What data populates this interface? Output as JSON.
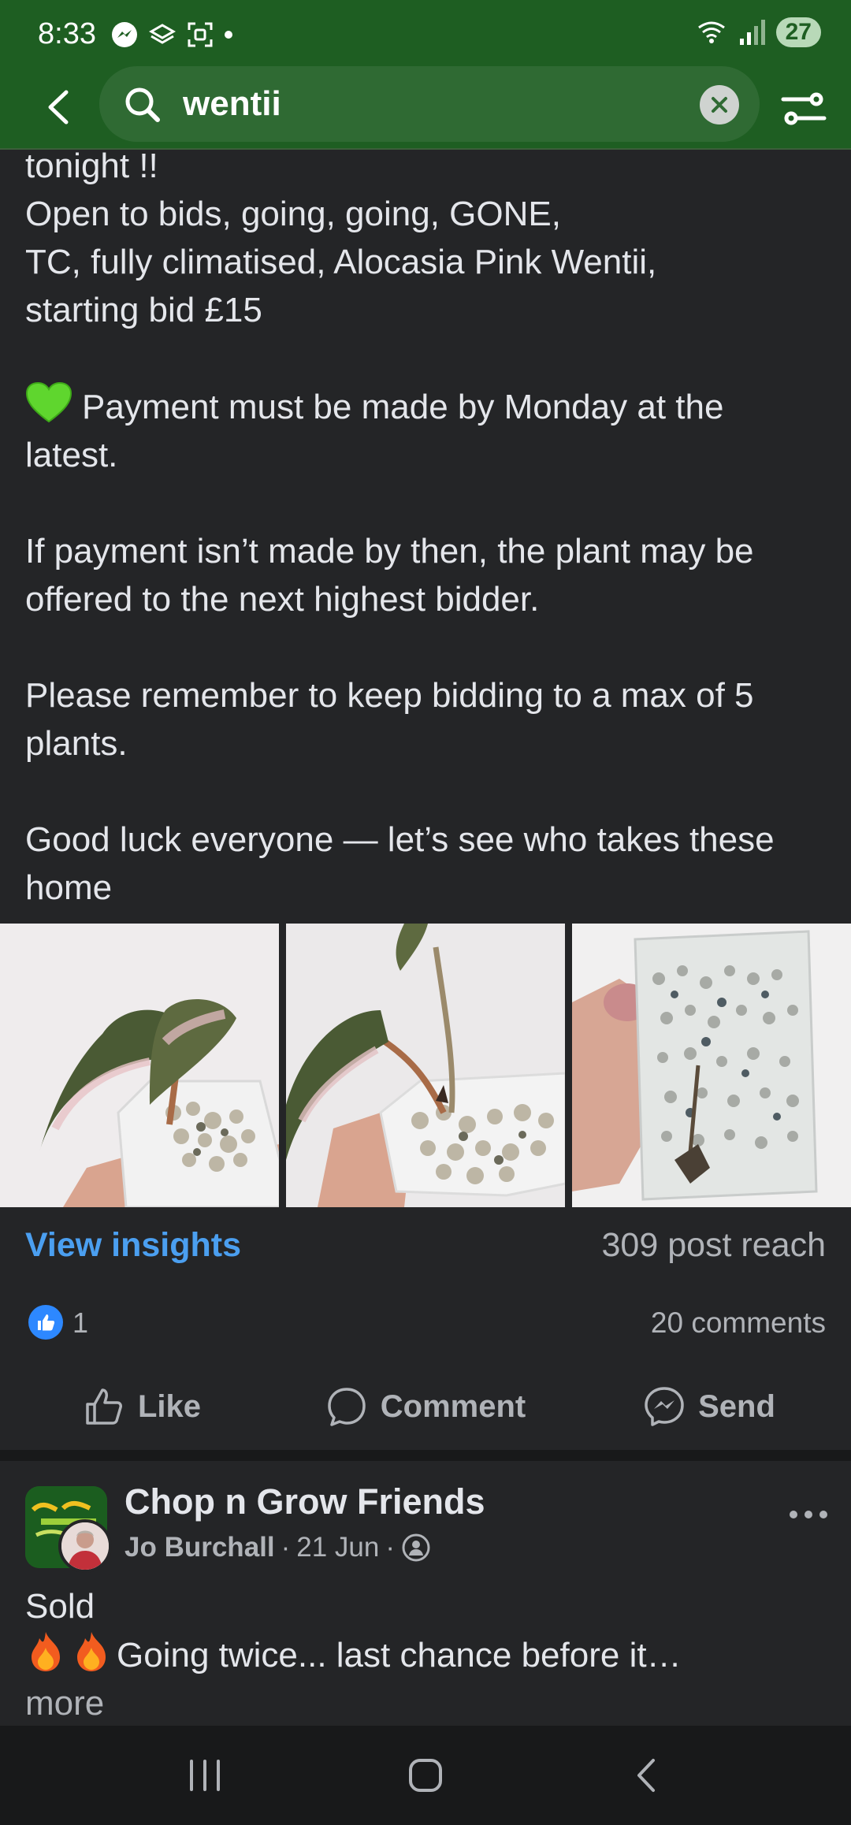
{
  "status_bar": {
    "time": "8:33",
    "battery": "27",
    "icons": [
      "messenger-icon",
      "layers-icon",
      "screenshot-icon",
      "dot-icon",
      "wifi-icon",
      "signal-icon"
    ]
  },
  "search": {
    "query": "wentii"
  },
  "post": {
    "text_lines": [
      "tonight !!",
      "Open to bids, going, going, GONE,",
      "TC, fully climatised, Alocasia Pink Wentii,",
      "starting bid £15"
    ],
    "payment_line_1": "Payment must be made by Monday at the",
    "payment_line_2": "latest.",
    "notice_line_1": "If payment isn’t made by then, the plant may be",
    "notice_line_2": "offered to the next highest bidder.",
    "reminder_line_1": "Please remember to keep bidding to a max of 5",
    "reminder_line_2": "plants.",
    "goodluck_line_1": "Good luck everyone — let’s see who takes these",
    "goodluck_line_2": "home",
    "view_insights": "View insights",
    "post_reach": "309 post reach",
    "like_count": "1",
    "comment_count": "20 comments",
    "actions": {
      "like": "Like",
      "comment": "Comment",
      "send": "Send"
    }
  },
  "post2": {
    "group_name": "Chop n Grow Friends",
    "author": "Jo Burchall",
    "date": "21 Jun",
    "text_line_1": "Sold",
    "text_line_2": "Going twice... last chance before it…",
    "more": "more"
  },
  "colors": {
    "header_green": "#1e5e22",
    "link_blue": "#4b9ff0",
    "background": "#242527"
  }
}
